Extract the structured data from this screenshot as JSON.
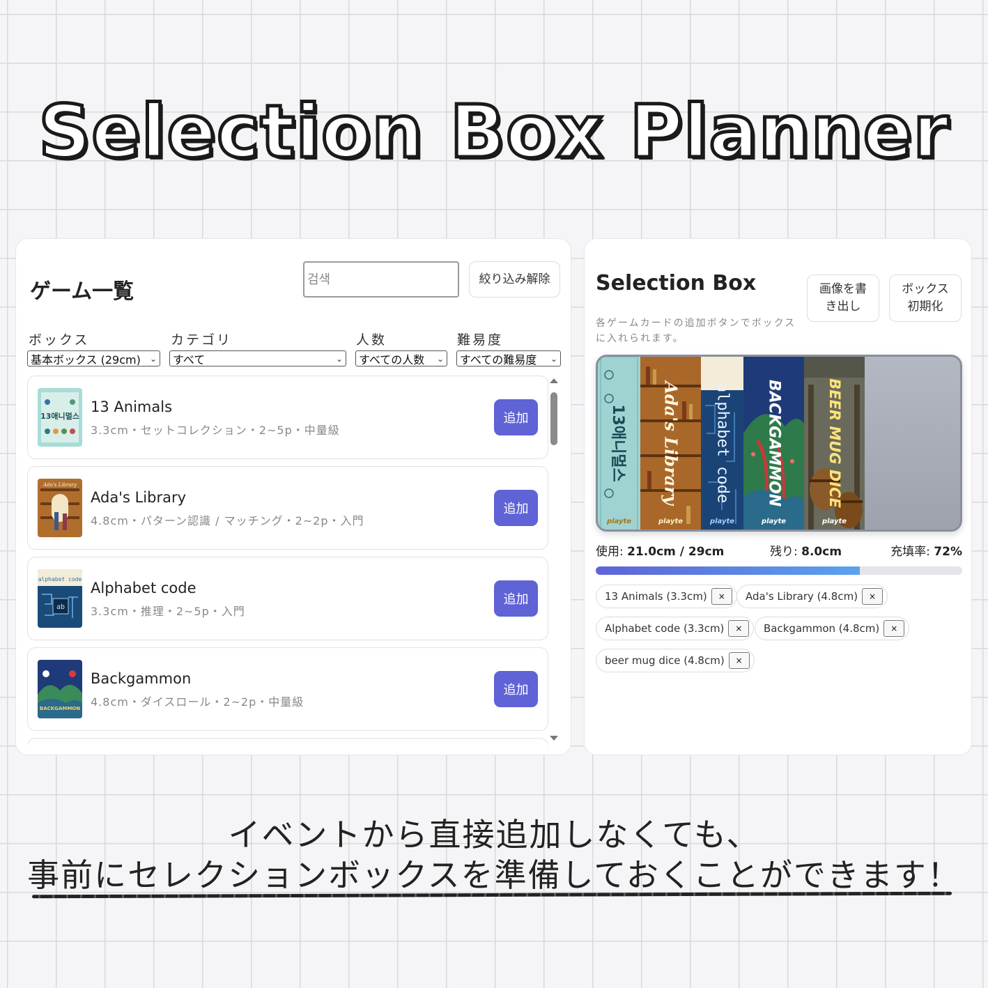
{
  "hero_title": "Selection Box Planner",
  "game_list": {
    "title": "ゲーム一覧",
    "search_placeholder": "검색",
    "clear_filters_label": "絞り込み解除",
    "filters": [
      {
        "label": "ボックス",
        "value": "基本ボックス (29cm)"
      },
      {
        "label": "カテゴリ",
        "value": "すべて"
      },
      {
        "label": "人数",
        "value": "すべての人数"
      },
      {
        "label": "難易度",
        "value": "すべての難易度"
      }
    ],
    "add_label": "追加",
    "games": [
      {
        "name": "13 Animals",
        "meta": "3.3cm・セットコレクション・2~5p・中量級",
        "thumb_text": "13애니멀스",
        "thumb_color": "#8ec9c8"
      },
      {
        "name": "Ada's Library",
        "meta": "4.8cm・パターン認識 / マッチング・2~2p・入門",
        "thumb_text": "Ada's Library",
        "thumb_color": "#b8702c"
      },
      {
        "name": "Alphabet code",
        "meta": "3.3cm・推理・2~5p・入門",
        "thumb_text": "alphabet code",
        "thumb_color": "#1b4a7a"
      },
      {
        "name": "Backgammon",
        "meta": "4.8cm・ダイスロール・2~2p・中量級",
        "thumb_text": "BACKGAMMON",
        "thumb_color": "#1e3f7a"
      }
    ]
  },
  "selection_box": {
    "title": "Selection Box",
    "description": "各ゲームカードの追加ボタンでボックスに入れられます。",
    "export_label": "画像を書き出し",
    "reset_label": "ボックス初期化",
    "spines": [
      {
        "text": "13애니멀스",
        "bg": "#9fd3d1",
        "fg": "#184b57",
        "logo": "playte",
        "width_cm": 3.3
      },
      {
        "text": "Ada's Library",
        "bg": "#a9682a",
        "fg": "#fff7e0",
        "logo": "playte",
        "width_cm": 4.8
      },
      {
        "text": "alphabet code",
        "bg": "#1b4476",
        "fg": "#e8f4ff",
        "logo": "playte",
        "width_cm": 3.3
      },
      {
        "text": "BACKGAMMON",
        "bg": "#1e3a78",
        "fg": "#ffffff",
        "logo": "playte",
        "width_cm": 4.8
      },
      {
        "text": "BEER MUG DICE",
        "bg": "#6a6a5c",
        "fg": "#ffe27a",
        "logo": "playte",
        "width_cm": 4.8
      }
    ],
    "stats": {
      "used_label": "使用:",
      "used_value": "21.0cm / 29cm",
      "remaining_label": "残り:",
      "remaining_value": "8.0cm",
      "fill_label": "充填率:",
      "fill_value": "72%"
    },
    "fill_ratio": 0.72,
    "chip_remove": "×",
    "chips": [
      "13 Animals (3.3cm)",
      "Ada's Library (4.8cm)",
      "Alphabet code (3.3cm)",
      "Backgammon (4.8cm)",
      "beer mug dice (4.8cm)"
    ]
  },
  "caption": {
    "line1": "イベントから直接追加しなくても、",
    "line2": "事前にセレクションボックスを準備しておくことができます！"
  },
  "colors": {
    "accent": "#5f63d6",
    "progress_end": "#5aa3ee"
  }
}
